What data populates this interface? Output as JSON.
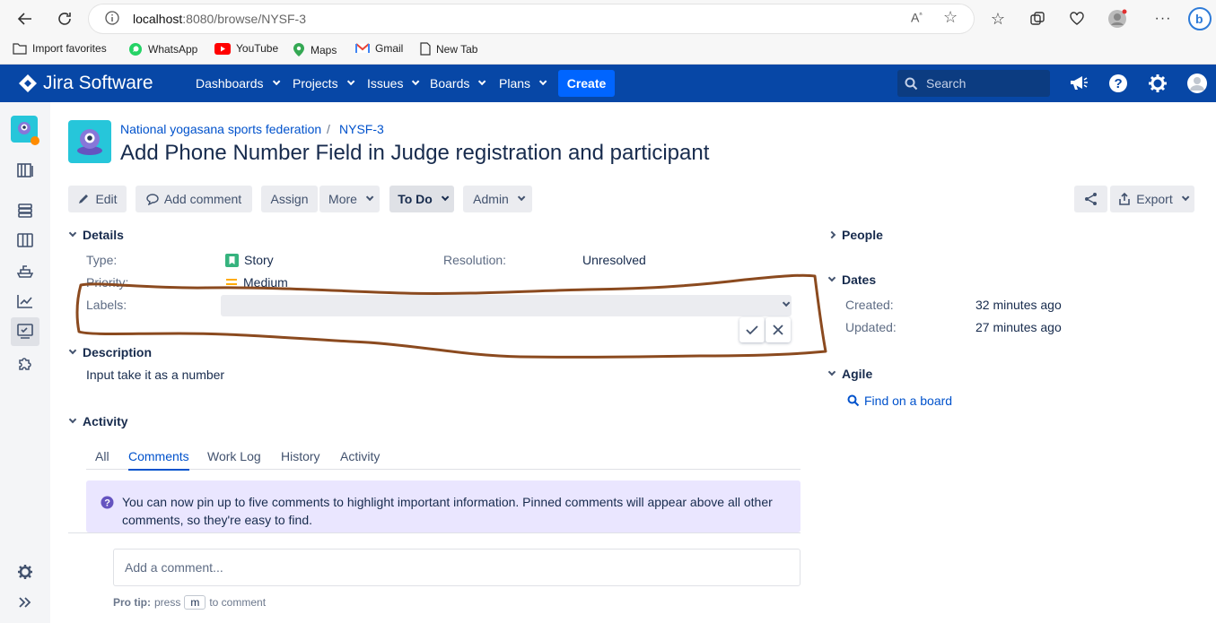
{
  "browser": {
    "url_host": "localhost",
    "url_path": ":8080/browse/NYSF-3",
    "bookmarks": [
      "Import favorites",
      "WhatsApp",
      "YouTube",
      "Maps",
      "Gmail",
      "New Tab"
    ]
  },
  "jira_nav": {
    "brand": "Jira Software",
    "menus": [
      "Dashboards",
      "Projects",
      "Issues",
      "Boards",
      "Plans"
    ],
    "create_label": "Create",
    "search_placeholder": "Search"
  },
  "issue": {
    "project": "National yogasana sports federation",
    "key": "NYSF-3",
    "title": "Add Phone Number Field in Judge registration and participant"
  },
  "toolbar": {
    "edit": "Edit",
    "add_comment": "Add comment",
    "assign": "Assign",
    "more": "More",
    "status": "To Do",
    "admin": "Admin",
    "export": "Export"
  },
  "details": {
    "heading": "Details",
    "type_label": "Type:",
    "type_value": "Story",
    "resolution_label": "Resolution:",
    "resolution_value": "Unresolved",
    "priority_label": "Priority:",
    "priority_value": "Medium",
    "labels_label": "Labels:"
  },
  "description": {
    "heading": "Description",
    "text": "Input take it as a number"
  },
  "activity": {
    "heading": "Activity",
    "tabs": [
      "All",
      "Comments",
      "Work Log",
      "History",
      "Activity"
    ],
    "active_tab": "Comments",
    "info_text": "You can now pin up to five comments to highlight important information. Pinned comments will appear above all other comments, so they're easy to find.",
    "comment_placeholder": "Add a comment...",
    "protip_prefix": "Pro tip:",
    "protip_press": "press",
    "protip_key": "m",
    "protip_suffix": "to comment"
  },
  "right_panel": {
    "people": "People",
    "dates": "Dates",
    "created_label": "Created:",
    "created_value": "32 minutes ago",
    "updated_label": "Updated:",
    "updated_value": "27 minutes ago",
    "agile": "Agile",
    "find_on_board": "Find on a board"
  },
  "colors": {
    "jira_nav_bg": "#0747a6",
    "create_btn": "#0065ff",
    "link": "#0052cc",
    "annotation": "#8b4a1f",
    "story_icon": "#36b37e",
    "priority_medium": "#ffab00",
    "info_bg": "#eae6ff"
  }
}
